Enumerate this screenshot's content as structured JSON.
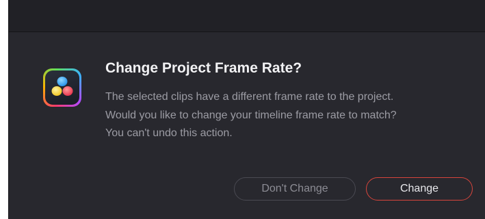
{
  "dialog": {
    "title": "Change Project Frame Rate?",
    "message": "The selected clips have a different frame rate to the project. Would you like to change your timeline frame rate to match? You can't undo this action.",
    "icon": "davinci-resolve-app-icon"
  },
  "buttons": {
    "secondary_label": "Don't Change",
    "primary_label": "Change"
  },
  "colors": {
    "background": "#28282e",
    "titlebar": "#212126",
    "accent": "#d8453c",
    "title_text": "#f2f2f4",
    "body_text": "#9c9ca4"
  }
}
